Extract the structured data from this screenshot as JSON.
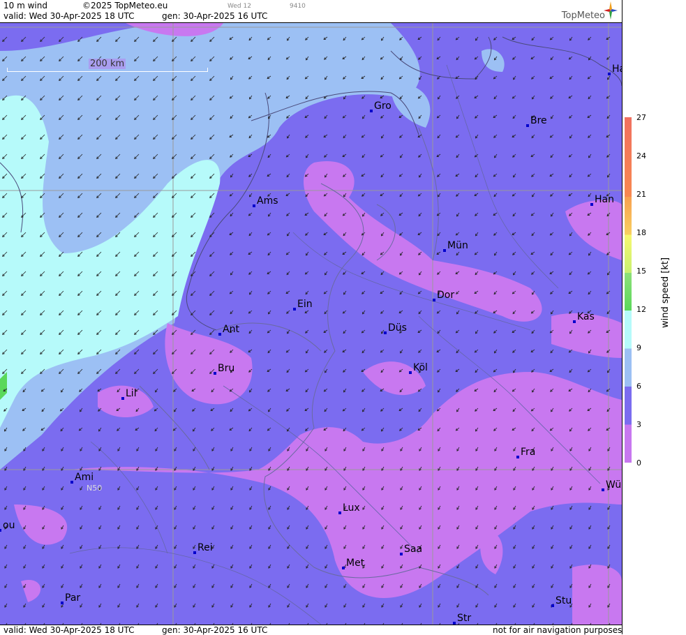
{
  "header": {
    "product": "10 m wind",
    "copyright": "©2025 TopMeteo.eu",
    "day_small": "Wed 12",
    "code_small": "9410",
    "valid": "valid:  Wed  30-Apr-2025  18 UTC",
    "gen": "gen: 30-Apr-2025 16 UTC",
    "logo": "TopMeteo"
  },
  "footer": {
    "valid": "valid:  Wed  30-Apr-2025  18 UTC",
    "gen": "gen: 30-Apr-2025 16 UTC",
    "note": "not for air navigation purposes"
  },
  "map": {
    "scale_label": "200 km",
    "lat_label": "N50",
    "cities": [
      "Ha",
      "Gro",
      "Bre",
      "Ams",
      "Han",
      "Mün",
      "Ein",
      "Dor",
      "Ant",
      "Düs",
      "Kas",
      "Bru",
      "Köl",
      "Lil",
      "Fra",
      "Ami",
      "Wü",
      "Lux",
      "ou",
      "Rei",
      "Saa",
      "Met",
      "Par",
      "Stu",
      "Str"
    ]
  },
  "legend": {
    "title": "wind  speed  [kt]",
    "ticks": [
      "27",
      "24",
      "21",
      "18",
      "15",
      "12",
      "9",
      "6",
      "3",
      "0"
    ],
    "colors": {
      "0-2": "#c878f0",
      "2-4": "#7b6cf0",
      "4-6": "#9cc0f4",
      "6-9": "#b6fafa",
      "9-12": "#5ad85a",
      "12-15": "#c8f070",
      "15-18": "#f8f870",
      "18-21": "#f8d060",
      "21-24": "#f8a050",
      "24-27": "#f07060"
    }
  }
}
